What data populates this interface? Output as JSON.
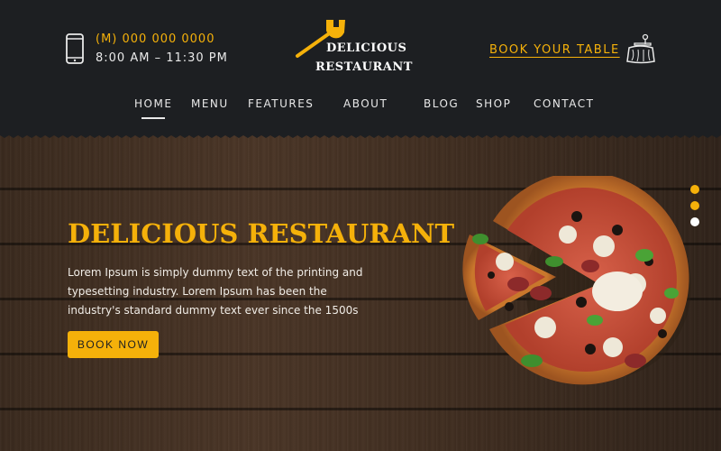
{
  "header": {
    "phone": "(M) 000 000 0000",
    "hours": "8:00 AM – 11:30 PM",
    "logo_line1": "DELICIOUS",
    "logo_line2": "RESTAURANT",
    "book_table": "BOOK YOUR TABLE"
  },
  "nav": {
    "items": [
      {
        "label": "HOME",
        "active": true
      },
      {
        "label": "MENU"
      },
      {
        "label": "FEATURES"
      },
      {
        "label": "ABOUT"
      },
      {
        "label": "BLOG"
      },
      {
        "label": "SHOP"
      },
      {
        "label": "CONTACT"
      }
    ]
  },
  "hero": {
    "title": "DELICIOUS RESTAURANT",
    "text": "Lorem Ipsum is simply dummy text of the printing and typesetting industry. Lorem Ipsum has been the industry's standard dummy text ever since the 1500s",
    "button": "BOOK NOW",
    "slider": {
      "count": 3,
      "active_index": 0
    }
  },
  "colors": {
    "accent": "#f5b10a",
    "header_bg": "#1d1f22",
    "text_light": "#e9e9e9"
  },
  "icons": {
    "phone": "phone-icon",
    "logo": "fork-icon",
    "table": "table-icon"
  }
}
